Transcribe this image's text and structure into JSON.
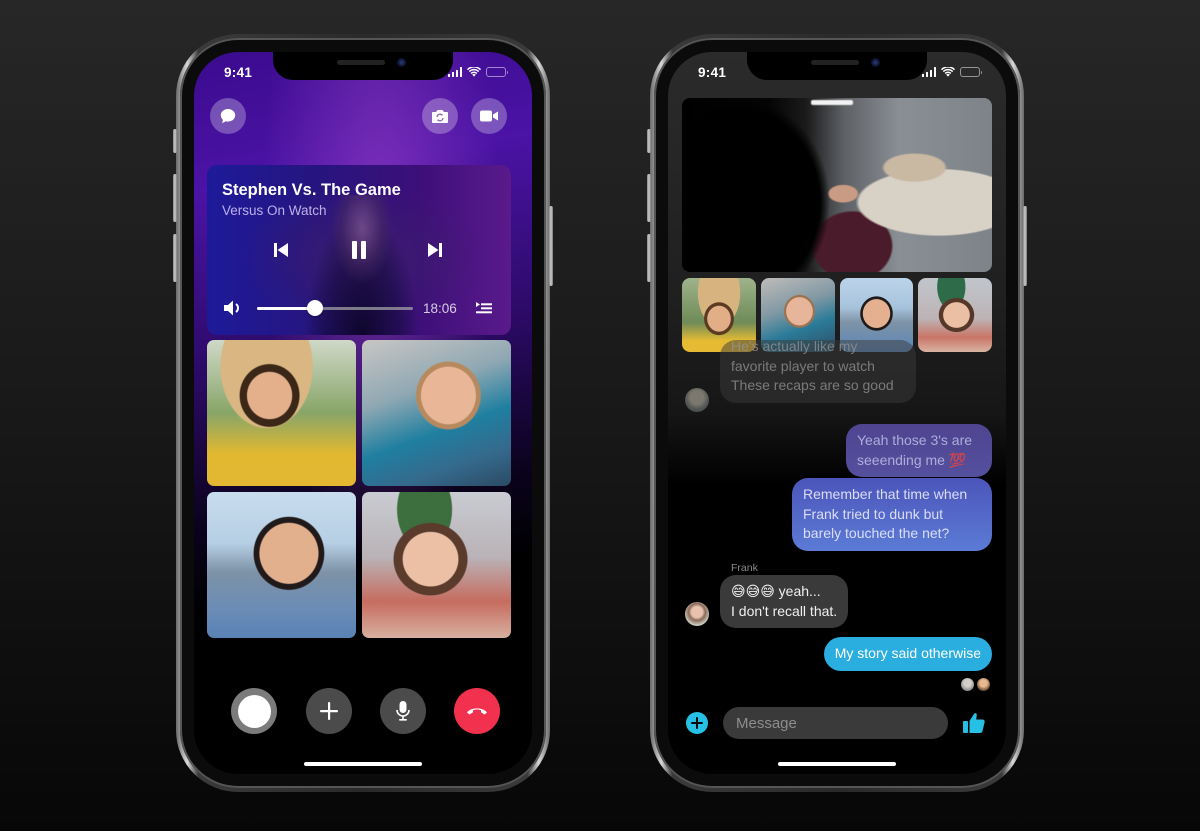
{
  "colors": {
    "accent_blue": "#2aaee0",
    "end_call_red": "#f2314f",
    "messenger_cyan": "#26c0e4",
    "bubble_purple": "#54509e",
    "bubble_blue": "#5b7bd6",
    "bubble_gray": "#3a3a3a"
  },
  "left_phone": {
    "status_bar": {
      "time": "9:41"
    },
    "top_buttons": [
      {
        "icon": "chat-bubble-icon"
      },
      {
        "icon": "flip-camera-icon"
      },
      {
        "icon": "video-camera-icon"
      }
    ],
    "watch_together": {
      "title": "Stephen Vs. The Game",
      "subtitle": "Versus On Watch",
      "controls": [
        "previous-track-icon",
        "pause-icon",
        "next-track-icon"
      ],
      "progress_percent": 37,
      "time_remaining": "18:06",
      "volume_icon": "speaker-icon",
      "queue_icon": "queue-list-icon"
    },
    "participants": [
      {
        "label": "Participant 1"
      },
      {
        "label": "Participant 2"
      },
      {
        "label": "Participant 3"
      },
      {
        "label": "Participant 4"
      }
    ],
    "call_controls": [
      {
        "name": "capture",
        "icon": "capture-circle-icon"
      },
      {
        "name": "add",
        "icon": "plus-icon"
      },
      {
        "name": "mute",
        "icon": "microphone-icon"
      },
      {
        "name": "end-call",
        "icon": "hang-up-phone-icon"
      }
    ]
  },
  "right_phone": {
    "status_bar": {
      "time": "9:41"
    },
    "messages": [
      {
        "direction": "incoming",
        "faded": true,
        "lines": [
          "He's actually like my",
          "favorite player to watch",
          "These recaps are so good"
        ]
      },
      {
        "direction": "outgoing",
        "lines": [
          "Yeah those 3's are",
          "seeending me 💯"
        ]
      },
      {
        "direction": "outgoing",
        "lines": [
          "Remember that time when",
          "Frank tried to dunk but",
          "barely touched the net?"
        ]
      },
      {
        "direction": "incoming",
        "sender": "Frank",
        "lines": [
          "😅😅😅 yeah...",
          "I don't recall that."
        ]
      },
      {
        "direction": "outgoing",
        "lines": [
          "My story said otherwise"
        ]
      }
    ],
    "composer": {
      "placeholder": "Message",
      "value": "",
      "add_icon": "plus-circle-icon",
      "like_icon": "thumbs-up-icon"
    }
  }
}
